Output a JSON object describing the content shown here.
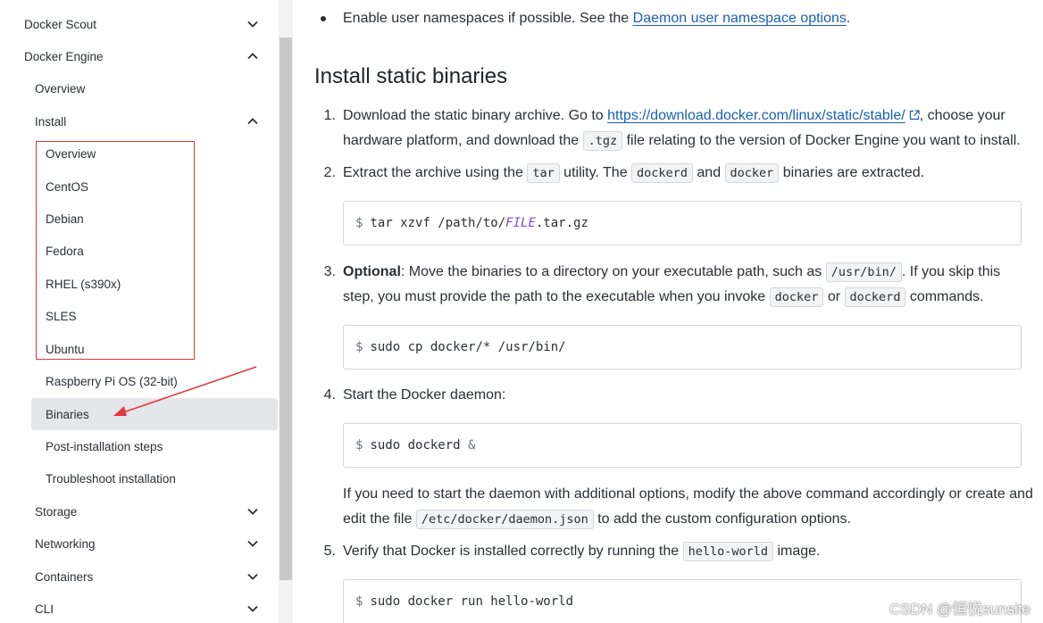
{
  "sidebar": {
    "items": [
      {
        "label": "Docker Scout",
        "chevron": "down"
      },
      {
        "label": "Docker Engine",
        "chevron": "up"
      },
      {
        "label": "Overview"
      },
      {
        "label": "Install",
        "chevron": "up"
      },
      {
        "label": "Overview"
      },
      {
        "label": "CentOS"
      },
      {
        "label": "Debian"
      },
      {
        "label": "Fedora"
      },
      {
        "label": "RHEL (s390x)"
      },
      {
        "label": "SLES"
      },
      {
        "label": "Ubuntu"
      },
      {
        "label": "Raspberry Pi OS (32-bit)"
      },
      {
        "label": "Binaries",
        "active": true
      },
      {
        "label": "Post-installation steps"
      },
      {
        "label": "Troubleshoot installation"
      },
      {
        "label": "Storage",
        "chevron": "down"
      },
      {
        "label": "Networking",
        "chevron": "down"
      },
      {
        "label": "Containers",
        "chevron": "down"
      },
      {
        "label": "CLI",
        "chevron": "down"
      }
    ]
  },
  "content": {
    "bullet": {
      "text": "Enable user namespaces if possible. See the ",
      "link": "Daemon user namespace options",
      "after": "."
    },
    "heading": "Install static binaries",
    "steps": {
      "s1": {
        "num": "1.",
        "a": "Download the static binary archive. Go to ",
        "link": "https://download.docker.com/linux/static/stable/",
        "b": ", choose your",
        "c": "hardware platform, and download the ",
        "code": ".tgz",
        "d": " file relating to the version of Docker Engine you want to install."
      },
      "s2": {
        "num": "2.",
        "a": "Extract the archive using the ",
        "code1": "tar",
        "b": " utility. The ",
        "code2": "dockerd",
        "c": " and ",
        "code3": "docker",
        "d": " binaries are extracted.",
        "cmd": {
          "prompt": "$",
          "pre": "tar xzvf /path/to/",
          "placeholder": "FILE",
          "post": ".tar.gz"
        }
      },
      "s3": {
        "num": "3.",
        "bold": "Optional",
        "a": ": Move the binaries to a directory on your executable path, such as ",
        "code1": "/usr/bin/",
        "b": ". If you skip this",
        "c": "step, you must provide the path to the executable when you invoke ",
        "code2": "docker",
        "d": " or ",
        "code3": "dockerd",
        "e": " commands.",
        "cmd": {
          "prompt": "$",
          "text": "sudo cp docker/* /usr/bin/"
        }
      },
      "s4": {
        "num": "4.",
        "a": "Start the Docker daemon:",
        "cmd": {
          "prompt": "$",
          "text": "sudo dockerd ",
          "amp": "&"
        },
        "note1": "If you need to start the daemon with additional options, modify the above command accordingly or create and",
        "note2a": "edit the file ",
        "note_code": "/etc/docker/daemon.json",
        "note2b": " to add the custom configuration options."
      },
      "s5": {
        "num": "5.",
        "a": "Verify that Docker is installed correctly by running the ",
        "code": "hello-world",
        "b": " image.",
        "cmd": {
          "prompt": "$",
          "text": "sudo docker run hello-world"
        }
      }
    }
  },
  "watermark": "CSDN @恒悦sunsite",
  "colors": {
    "link": "#1a5fb4",
    "annotation": "#e0383b",
    "active_bg": "#e4e6ea"
  }
}
